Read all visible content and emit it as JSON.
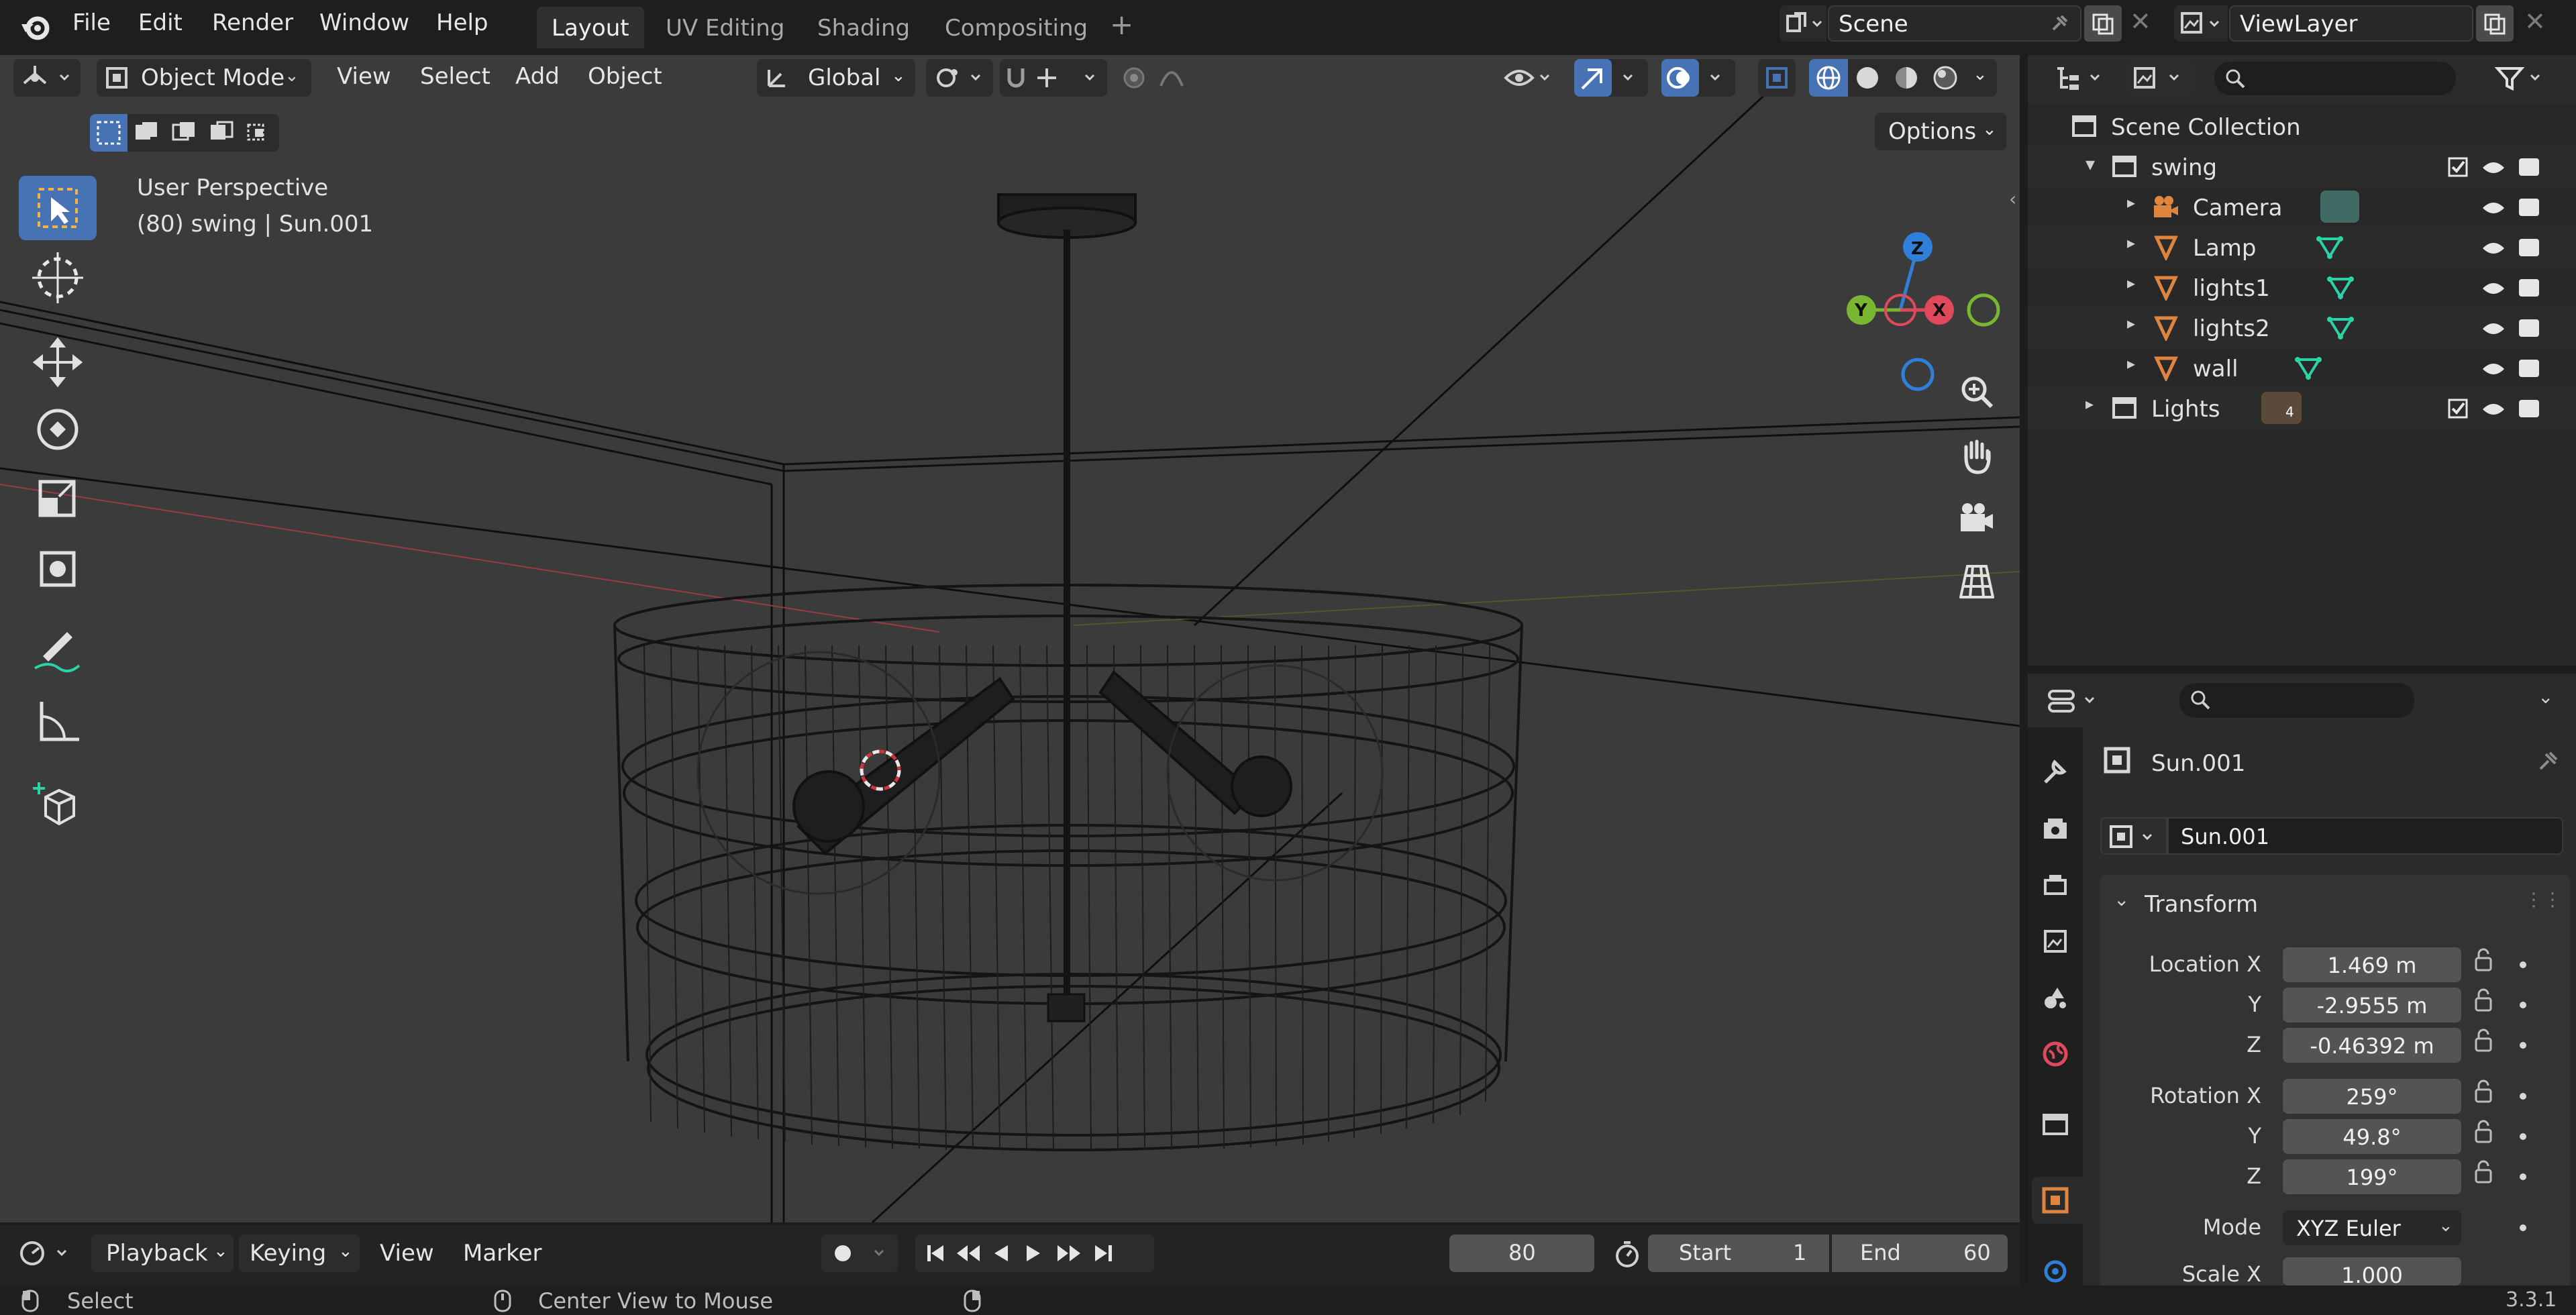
{
  "topbar": {
    "menus": [
      "File",
      "Edit",
      "Render",
      "Window",
      "Help"
    ],
    "workspaces": [
      "Layout",
      "UV Editing",
      "Shading",
      "Compositing"
    ],
    "active_workspace": "Layout",
    "scene": "Scene",
    "view_layer": "ViewLayer"
  },
  "viewport_header": {
    "mode": "Object Mode",
    "menus": [
      "View",
      "Select",
      "Add",
      "Object"
    ],
    "orientation": "Global",
    "options": "Options"
  },
  "viewport": {
    "perspective": "User Perspective",
    "object_info": "(80) swing | Sun.001",
    "gizmo": {
      "z": "Z",
      "y": "Y",
      "x": "X"
    }
  },
  "outliner": {
    "root": "Scene Collection",
    "items": [
      {
        "label": "swing",
        "level": 1
      },
      {
        "label": "Camera",
        "level": 2
      },
      {
        "label": "Lamp",
        "level": 2
      },
      {
        "label": "lights1",
        "level": 2
      },
      {
        "label": "lights2",
        "level": 2
      },
      {
        "label": "wall",
        "level": 2
      },
      {
        "label": "Lights",
        "level": 1,
        "badge": "4"
      }
    ]
  },
  "properties": {
    "object_name": "Sun.001",
    "datablock_name": "Sun.001",
    "panel_title": "Transform",
    "location": {
      "label_x": "Location X",
      "label_y": "Y",
      "label_z": "Z",
      "x": "1.469 m",
      "y": "-2.9555 m",
      "z": "-0.46392 m"
    },
    "rotation": {
      "label_x": "Rotation X",
      "label_y": "Y",
      "label_z": "Z",
      "x": "259°",
      "y": "49.8°",
      "z": "199°"
    },
    "mode_label": "Mode",
    "mode_value": "XYZ Euler",
    "scale_label": "Scale X",
    "scale_x": "1.000"
  },
  "timeline": {
    "menus": [
      "Playback",
      "Keying",
      "View",
      "Marker"
    ],
    "current_frame": "80",
    "start_label": "Start",
    "start": "1",
    "end_label": "End",
    "end": "60"
  },
  "statusbar": {
    "left": "Select",
    "middle": "Center View to Mouse",
    "version": "3.3.1"
  },
  "colors": {
    "accent": "#4772b3",
    "object_orange": "#e0853f",
    "mesh_green": "#2ad3a6",
    "axis_x": "#e0485b",
    "axis_y": "#7ab632",
    "axis_z": "#2f80d8"
  }
}
